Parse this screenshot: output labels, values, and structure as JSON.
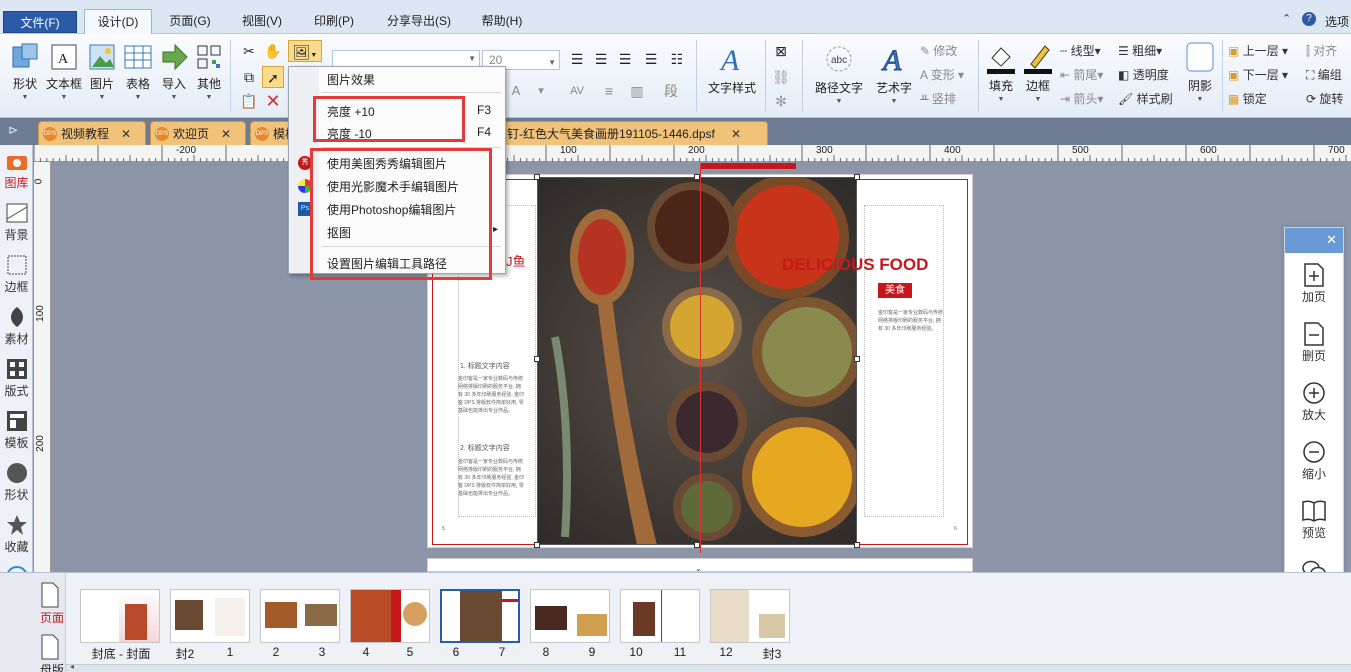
{
  "menu": {
    "file": "文件(F)",
    "tabs": [
      "设计(D)",
      "页面(G)",
      "视图(V)",
      "印刷(P)",
      "分享导出(S)",
      "帮助(H)"
    ],
    "options": "选项"
  },
  "ribbon": {
    "shape": "形状",
    "textbox": "文本框",
    "image": "图片",
    "table": "表格",
    "import": "导入",
    "other": "其他",
    "font_size": "20",
    "text_style": "文字样式",
    "path_text": "路径文字",
    "art_text": "艺术字",
    "modify": "修改",
    "transform": "变形",
    "vertical": "竖排",
    "fill": "填充",
    "border": "边框",
    "line_type": "线型",
    "arrow_end": "箭尾",
    "arrow_head": "箭头",
    "bold": "粗细",
    "transparency": "透明度",
    "format_brush": "样式刷",
    "shadow": "阴影",
    "bring_up": "上一层",
    "send_down": "下一层",
    "lock": "锁定",
    "align": "对齐",
    "group": "编组",
    "rotate": "旋转"
  },
  "tabs": [
    "视频教程",
    "欢迎页",
    "模板",
    "钉-红色大气美食画册191105-1446.dpsf"
  ],
  "left_panel": [
    "图库",
    "背景",
    "边框",
    "素材",
    "版式",
    "模板",
    "形状",
    "收藏",
    "客服"
  ],
  "ruler": {
    "h": [
      "-200",
      "100",
      "200",
      "300",
      "400",
      "500",
      "600",
      "700"
    ],
    "v": [
      "0",
      "100",
      "200"
    ]
  },
  "context_menu": {
    "title": "图片效果",
    "brightness_up": "亮度 +10",
    "brightness_up_key": "F3",
    "brightness_down": "亮度 -10",
    "brightness_down_key": "F4",
    "meitu": "使用美图秀秀编辑图片",
    "lightmagic": "使用光影魔术手编辑图片",
    "photoshop": "使用Photoshop编辑图片",
    "cutout": "抠图",
    "set_path": "设置图片编辑工具路径"
  },
  "page": {
    "left_title_fragment": "J鱼",
    "heading1": "1. 标题文字内容",
    "heading2": "2. 标题文字内容",
    "body": [
      "金印客是一家专业数码与传统",
      "网络排版印刷的服务平台, 拥",
      "有 30 多年印刷服务经验, 金印",
      "客 DPS 排版软件简单好用, 零",
      "基础也能排出专业作品。"
    ],
    "delicious": "DELICIOUS  FOOD",
    "meishi": "美食",
    "right_body": [
      "金印客是一家专业数码与传统",
      "网络排版印刷的服务平台, 拥",
      "有 30 多年印刷服务经验。"
    ],
    "page_left_num": "5",
    "page_right_num": "6"
  },
  "right_panel": [
    "加页",
    "删页",
    "放大",
    "缩小",
    "预览",
    "分享"
  ],
  "bottom": {
    "page": "页面",
    "master": "母版",
    "thumb_labels": [
      "封底 - 封面",
      "封2",
      "1",
      "2",
      "3",
      "4",
      "5",
      "6",
      "7",
      "8",
      "9",
      "10",
      "11",
      "12",
      "封3"
    ]
  },
  "colors": {
    "accent_red": "#c8161d",
    "highlight": "#e33a3a",
    "menu_blue": "#2a5aa8"
  }
}
